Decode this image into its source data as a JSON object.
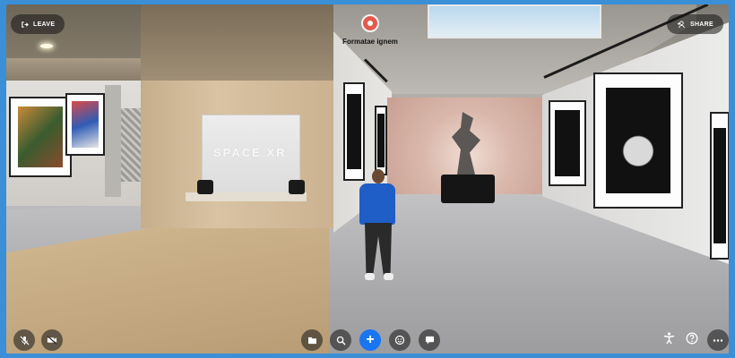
{
  "header": {
    "leave_label": "LEAVE",
    "share_label": "SHARE",
    "host_name": "Formatae ignem"
  },
  "scene": {
    "screen_logo": "SPACE XR"
  },
  "colors": {
    "primary": "#1976f0",
    "host_avatar": "#e35a4c",
    "frame": "#3a8fd6"
  },
  "toolbar": {
    "left": [
      "mic-off-icon",
      "camera-off-icon"
    ],
    "center": [
      "folder-icon",
      "search-icon",
      "add-icon",
      "emoji-icon",
      "chat-icon"
    ],
    "right": [
      "accessibility-icon",
      "help-icon",
      "more-icon"
    ]
  }
}
